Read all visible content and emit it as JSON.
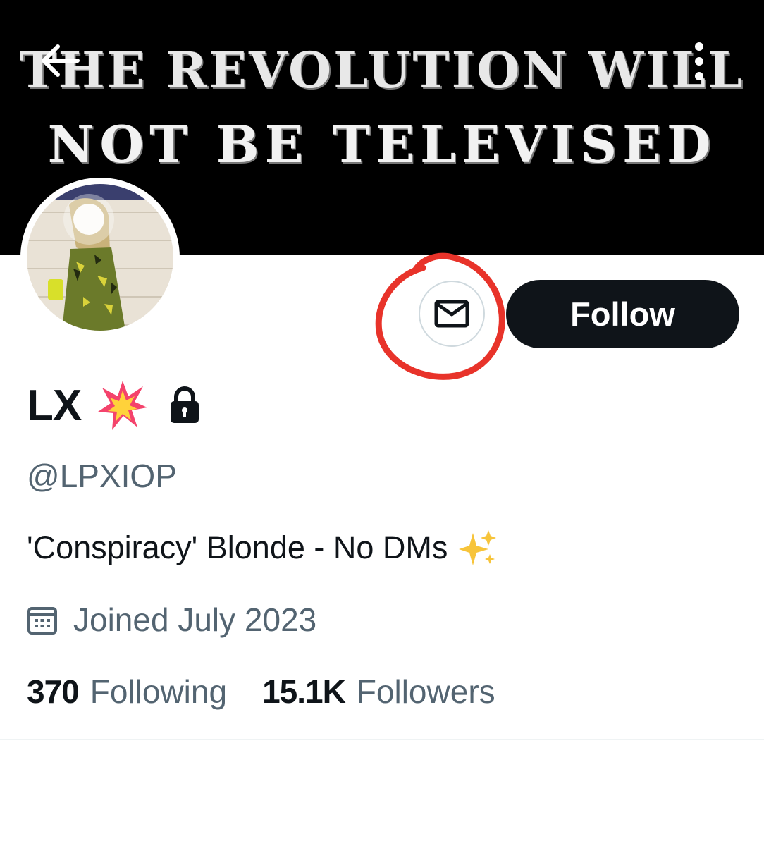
{
  "banner": {
    "line1": "THE REVOLUTION WILL",
    "line2": "NOT BE TELEVISED"
  },
  "icons": {
    "back": "arrow-left-icon",
    "more": "more-vertical-icon",
    "dm": "envelope-icon",
    "badge": "collision-emoji-icon",
    "lock": "lock-icon",
    "bio_emoji": "sparkles-emoji-icon",
    "calendar": "calendar-icon"
  },
  "profile": {
    "name": "LX",
    "handle": "@LPXIOP",
    "bio": "'Conspiracy' Blonde - No DMs",
    "joined": "Joined July 2023"
  },
  "actions": {
    "follow_label": "Follow"
  },
  "stats": {
    "following_count": "370",
    "following_label": "Following",
    "followers_count": "15.1K",
    "followers_label": "Followers"
  },
  "colors": {
    "annotation_circle": "#e8332a",
    "primary_text": "#0f1419",
    "secondary_text": "#536471",
    "follow_bg": "#0f1419"
  }
}
